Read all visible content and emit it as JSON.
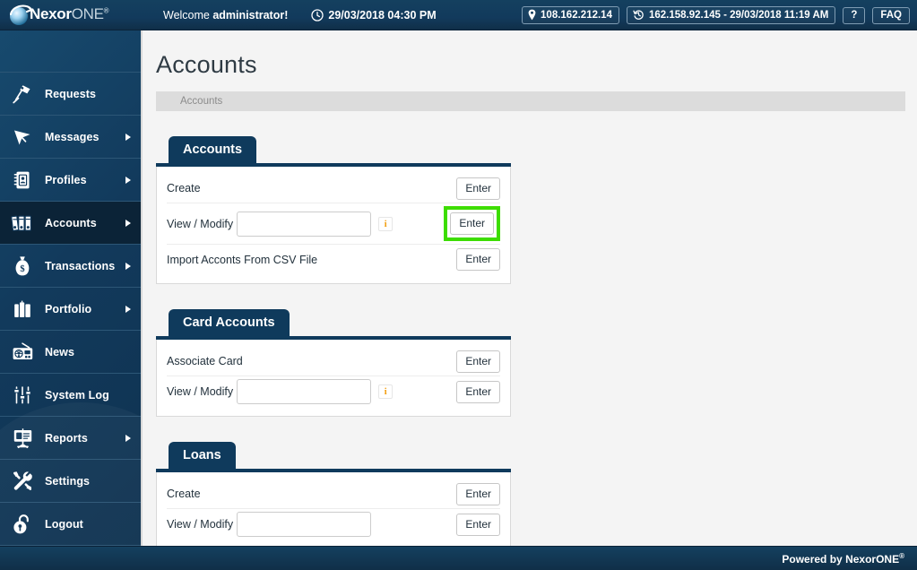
{
  "header": {
    "logo_text": "Nexor",
    "logo_text_light": "ONE",
    "logo_reg": "®",
    "welcome_prefix": "Welcome ",
    "welcome_user": "administrator!",
    "datetime": "29/03/2018 04:30 PM",
    "clock_icon": "clock-icon",
    "current_ip": "108.162.212.14",
    "current_ip_icon": "location-pin-icon",
    "last_login": "162.158.92.145 - 29/03/2018 11:19 AM",
    "last_login_icon": "history-clock-icon",
    "help_label": "?",
    "faq_label": "FAQ"
  },
  "sidebar": {
    "items": [
      {
        "label": "Requests",
        "icon": "desk-lamp-icon",
        "arrow": false,
        "active": false
      },
      {
        "label": "Messages",
        "icon": "paper-plane-icon",
        "arrow": true,
        "active": false
      },
      {
        "label": "Profiles",
        "icon": "address-book-icon",
        "arrow": true,
        "active": false
      },
      {
        "label": "Accounts",
        "icon": "binders-icon",
        "arrow": true,
        "active": true
      },
      {
        "label": "Transactions",
        "icon": "money-bag-icon",
        "arrow": true,
        "active": false
      },
      {
        "label": "Portfolio",
        "icon": "briefcase-icon",
        "arrow": true,
        "active": false
      },
      {
        "label": "News",
        "icon": "radio-icon",
        "arrow": false,
        "active": false
      },
      {
        "label": "System Log",
        "icon": "sliders-icon",
        "arrow": false,
        "active": false
      },
      {
        "label": "Reports",
        "icon": "presentation-icon",
        "arrow": true,
        "active": false
      },
      {
        "label": "Settings",
        "icon": "wrench-tools-icon",
        "arrow": false,
        "active": false
      },
      {
        "label": "Logout",
        "icon": "open-padlock-icon",
        "arrow": false,
        "active": false
      }
    ]
  },
  "main": {
    "page_title": "Accounts",
    "breadcrumb": "Accounts",
    "panels": [
      {
        "tab_label": "Accounts",
        "rows": [
          {
            "label": "Create",
            "has_input": false,
            "has_info": false,
            "button": "Enter",
            "highlighted": false
          },
          {
            "label": "View / Modify",
            "has_input": true,
            "input_value": "",
            "has_info": true,
            "button": "Enter",
            "highlighted": true
          },
          {
            "label": "Import Acconts From CSV File",
            "has_input": false,
            "has_info": false,
            "button": "Enter",
            "highlighted": false
          }
        ]
      },
      {
        "tab_label": "Card Accounts",
        "rows": [
          {
            "label": "Associate Card",
            "has_input": false,
            "has_info": false,
            "button": "Enter",
            "highlighted": false
          },
          {
            "label": "View / Modify",
            "has_input": true,
            "input_value": "",
            "has_info": true,
            "button": "Enter",
            "highlighted": false
          }
        ]
      },
      {
        "tab_label": "Loans",
        "rows": [
          {
            "label": "Create",
            "has_input": false,
            "has_info": false,
            "button": "Enter",
            "highlighted": false
          },
          {
            "label": "View / Modify",
            "has_input": true,
            "input_value": "",
            "has_info": false,
            "button": "Enter",
            "highlighted": false
          }
        ]
      }
    ]
  },
  "footer": {
    "text": "Powered by NexorONE",
    "reg": "®"
  },
  "colors": {
    "navy": "#123a5c",
    "tab_navy": "#0f3a5c",
    "active_nav": "#0b2337",
    "highlight_green": "#3ddd00",
    "info_orange": "#f3a117",
    "breadcrumb_bg": "#dcdcdc"
  }
}
